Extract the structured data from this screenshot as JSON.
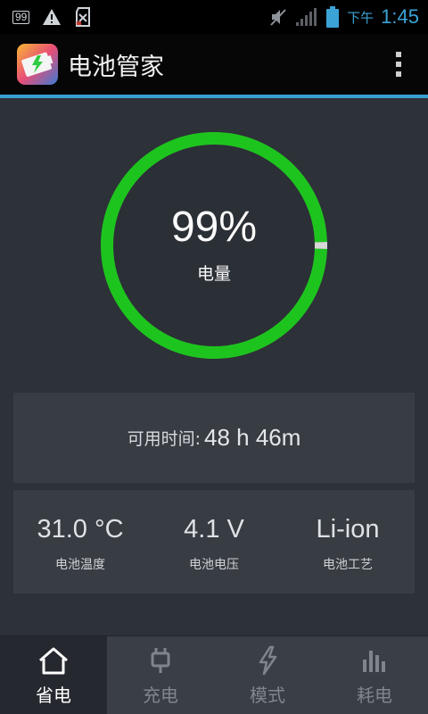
{
  "status_bar": {
    "badge": "99",
    "ampm": "下午",
    "time": "1:45",
    "battery_level": 0.99
  },
  "app": {
    "title": "电池管家"
  },
  "battery": {
    "percent_text": "99%",
    "level_label": "电量",
    "level": 0.99,
    "ring_color": "#1ec41e"
  },
  "time_card": {
    "label": "可用时间:",
    "value": "48 h 46m"
  },
  "stats": [
    {
      "value": "31.0 °C",
      "label": "电池温度"
    },
    {
      "value": "4.1 V",
      "label": "电池电压"
    },
    {
      "value": "Li-ion",
      "label": "电池工艺"
    }
  ],
  "nav": [
    {
      "label": "省电",
      "icon": "home-icon",
      "active": true
    },
    {
      "label": "充电",
      "icon": "plug-icon",
      "active": false
    },
    {
      "label": "模式",
      "icon": "lightning-icon",
      "active": false
    },
    {
      "label": "耗电",
      "icon": "bar-chart-icon",
      "active": false
    }
  ],
  "colors": {
    "accent": "#3aa0d1",
    "ring": "#1ec41e",
    "background": "#2d3138",
    "card": "#383c43"
  }
}
